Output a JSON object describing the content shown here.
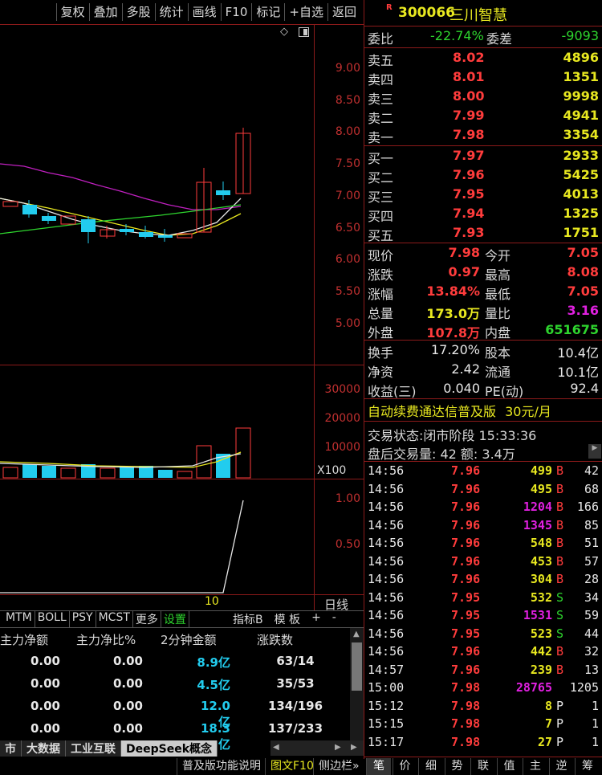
{
  "toolbar": {
    "items": [
      "复权",
      "叠加",
      "多股",
      "统计",
      "画线",
      "F10",
      "标记",
      "+自选",
      "返回"
    ]
  },
  "stock": {
    "badge": "R",
    "code": "300066",
    "name": "三川智慧"
  },
  "weibi": {
    "label": "委比",
    "pct": "-22.74%",
    "label2": "委差",
    "diff": "-9093"
  },
  "sells": [
    {
      "label": "卖五",
      "price": "8.02",
      "vol": "4896"
    },
    {
      "label": "卖四",
      "price": "8.01",
      "vol": "1351"
    },
    {
      "label": "卖三",
      "price": "8.00",
      "vol": "9998"
    },
    {
      "label": "卖二",
      "price": "7.99",
      "vol": "4941"
    },
    {
      "label": "卖一",
      "price": "7.98",
      "vol": "3354"
    }
  ],
  "buys": [
    {
      "label": "买一",
      "price": "7.97",
      "vol": "2933"
    },
    {
      "label": "买二",
      "price": "7.96",
      "vol": "5425"
    },
    {
      "label": "买三",
      "price": "7.95",
      "vol": "4013"
    },
    {
      "label": "买四",
      "price": "7.94",
      "vol": "1325"
    },
    {
      "label": "买五",
      "price": "7.93",
      "vol": "1751"
    }
  ],
  "quote": [
    {
      "l1": "现价",
      "v1": "7.98",
      "l2": "今开",
      "v2": "7.05"
    },
    {
      "l1": "涨跌",
      "v1": "0.97",
      "l2": "最高",
      "v2": "8.08"
    },
    {
      "l1": "涨幅",
      "v1": "13.84%",
      "l2": "最低",
      "v2": "7.05"
    },
    {
      "l1": "总量",
      "v1": "173.0万",
      "l2": "量比",
      "v2": "3.16"
    },
    {
      "l1": "外盘",
      "v1": "107.8万",
      "l2": "内盘",
      "v2": "651675"
    }
  ],
  "fund": [
    {
      "l1": "换手",
      "v1": "17.20%",
      "l2": "股本",
      "v2": "10.4亿"
    },
    {
      "l1": "净资",
      "v1": "2.42",
      "l2": "流通",
      "v2": "10.1亿"
    },
    {
      "l1": "收益(三)",
      "v1": "0.040",
      "l2": "PE(动)",
      "v2": "92.4"
    }
  ],
  "ad": {
    "text": "自动续费通达信普及版",
    "price": "30元/月"
  },
  "status": {
    "label": "交易状态:",
    "value": "闭市阶段 15:33:36"
  },
  "afterhours": {
    "text": "盘后交易量: 42  额: 3.4万"
  },
  "ticks": [
    {
      "t": "14:56",
      "p": "7.96",
      "v": "499",
      "bs": "B",
      "n": "42"
    },
    {
      "t": "14:56",
      "p": "7.96",
      "v": "495",
      "bs": "B",
      "n": "68"
    },
    {
      "t": "14:56",
      "p": "7.96",
      "v": "1204",
      "bs": "B",
      "n": "166"
    },
    {
      "t": "14:56",
      "p": "7.96",
      "v": "1345",
      "bs": "B",
      "n": "85"
    },
    {
      "t": "14:56",
      "p": "7.96",
      "v": "548",
      "bs": "B",
      "n": "51"
    },
    {
      "t": "14:56",
      "p": "7.96",
      "v": "453",
      "bs": "B",
      "n": "57"
    },
    {
      "t": "14:56",
      "p": "7.96",
      "v": "304",
      "bs": "B",
      "n": "28"
    },
    {
      "t": "14:56",
      "p": "7.95",
      "v": "532",
      "bs": "S",
      "n": "34"
    },
    {
      "t": "14:56",
      "p": "7.95",
      "v": "1531",
      "bs": "S",
      "n": "59"
    },
    {
      "t": "14:56",
      "p": "7.95",
      "v": "523",
      "bs": "S",
      "n": "44"
    },
    {
      "t": "14:56",
      "p": "7.96",
      "v": "442",
      "bs": "B",
      "n": "32"
    },
    {
      "t": "14:57",
      "p": "7.96",
      "v": "239",
      "bs": "B",
      "n": "13"
    },
    {
      "t": "15:00",
      "p": "7.98",
      "v": "28765",
      "bs": "",
      "n": "1205"
    },
    {
      "t": "15:12",
      "p": "7.98",
      "v": "8",
      "bs": "P",
      "n": "1"
    },
    {
      "t": "15:15",
      "p": "7.98",
      "v": "7",
      "bs": "P",
      "n": "1"
    },
    {
      "t": "15:17",
      "p": "7.98",
      "v": "27",
      "bs": "P",
      "n": "1"
    }
  ],
  "price_axis": [
    "9.00",
    "8.50",
    "8.00",
    "7.50",
    "7.00",
    "6.50",
    "6.00",
    "5.50",
    "5.00"
  ],
  "vol_axis": [
    "30000",
    "20000",
    "10000"
  ],
  "vol_unit": "X100",
  "ind_axis": [
    "1.00",
    "0.50"
  ],
  "date_label": "10",
  "period": "日线",
  "indicator_tabs": [
    "MTM",
    "BOLL",
    "PSY",
    "MCST",
    "更多",
    "设置"
  ],
  "indicator_right": [
    "指标B",
    "模 板",
    "+",
    "-"
  ],
  "fund_table": {
    "headers": [
      "主力净额",
      "主力净比%",
      "2分钟金额",
      "涨跌数"
    ],
    "rows": [
      [
        "0.00",
        "0.00",
        "8.9亿",
        "63/14"
      ],
      [
        "0.00",
        "0.00",
        "4.5亿",
        "35/53"
      ],
      [
        "0.00",
        "0.00",
        "12.0亿",
        "134/196"
      ],
      [
        "0.00",
        "0.00",
        "18.3亿",
        "137/233"
      ]
    ]
  },
  "sector_tabs": [
    "市",
    "大数据",
    "工业互联",
    "DeepSeek概念"
  ],
  "bottom_left": [
    "普及版功能说明",
    "图文F10",
    "侧边栏»"
  ],
  "bottom_right": [
    "笔",
    "价",
    "细",
    "势",
    "联",
    "值",
    "主",
    "逆",
    "筹"
  ],
  "colors": {
    "up": "#ff3c3c",
    "down": "#2ed52e",
    "cyan": "#22ccee",
    "yellow": "#e8e820",
    "magenta": "#e020e0"
  }
}
